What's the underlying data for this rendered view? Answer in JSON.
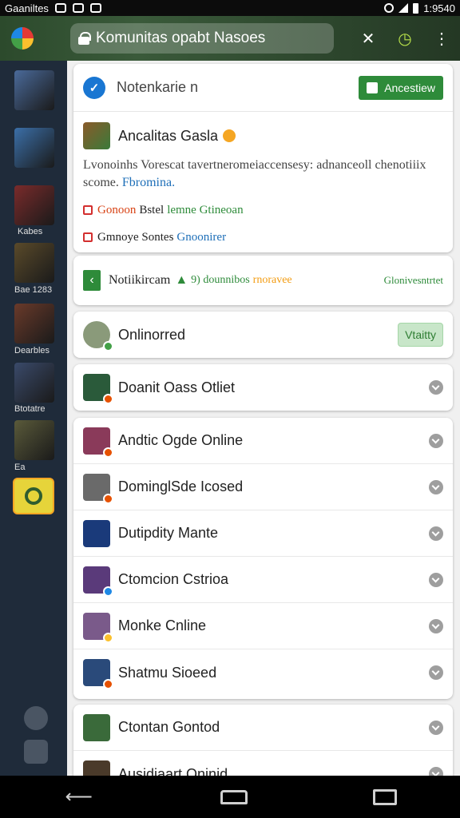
{
  "status_bar": {
    "carrier": "Gaaniltes",
    "time": "1:9540"
  },
  "app_bar": {
    "url": "Komunitas opabt Nasoes"
  },
  "sidebar": {
    "items": [
      {
        "label": "",
        "color": "#4a6a9a"
      },
      {
        "label": "",
        "color": "#3b6fa8"
      },
      {
        "label": "Kabes",
        "color": "#7a2b2b"
      },
      {
        "label": "Bae 1283",
        "color": "#5a4a2a"
      },
      {
        "label": "Dearbles",
        "color": "#6a3a2a"
      },
      {
        "label": "Btotatre",
        "color": "#3a4a6a"
      },
      {
        "label": "Ea",
        "color": "#5a5a3a"
      }
    ]
  },
  "notification": {
    "title": "Notenkarie n",
    "button_label": "Ancestiew",
    "game_name": "Ancalitas Gasla",
    "description": "Lvonoinhs Vorescat tavertneromeiaccensesy: adnanceoll chenotiiix scome.",
    "description_link": "Fbromina.",
    "detail_1": {
      "red": "Gonoon",
      "dark": "Bstel",
      "green": "lemne Gtineoan"
    },
    "detail_2": {
      "dark": "Gmnoye Sontes",
      "blue": "Gnoonirer"
    }
  },
  "promo": {
    "title": "Notiikircam",
    "green_text": "9) dounnibos",
    "orange_text": "rnoravee",
    "right_text": "Glonivesntrtet"
  },
  "online_card": {
    "label": "Onlinorred",
    "button": "Vtaitty"
  },
  "single_row": {
    "label": "Doanit Oass Otliet"
  },
  "list": [
    {
      "label": "Andtic Ogde Online",
      "color": "#8a3a5a",
      "dot": "#e65100"
    },
    {
      "label": "DominglSde Icosed",
      "color": "#6a6a6a",
      "dot": "#e65100"
    },
    {
      "label": "Dutipdity Mante",
      "color": "#1a3a7a",
      "dot": ""
    },
    {
      "label": "Ctomcion Cstrioa",
      "color": "#5a3a7a",
      "dot": "#1e88e5"
    },
    {
      "label": "Monke Cnline",
      "color": "#7a5a8a",
      "dot": "#fbc02d"
    },
    {
      "label": "Shatmu Sioeed",
      "color": "#2a4a7a",
      "dot": "#e65100"
    }
  ],
  "list_bottom": [
    {
      "label": "Ctontan Gontod",
      "color": "#3a6a3a",
      "dot": ""
    },
    {
      "label": "Ausidiaart Oninid",
      "color": "#4a3a2a",
      "dot": ""
    }
  ],
  "colors": {
    "accent_green": "#2e8b3a",
    "sidebar_bg": "#1f2b3a",
    "appbar_bg": "#2c4a2c",
    "link_blue": "#1e6fb8"
  }
}
